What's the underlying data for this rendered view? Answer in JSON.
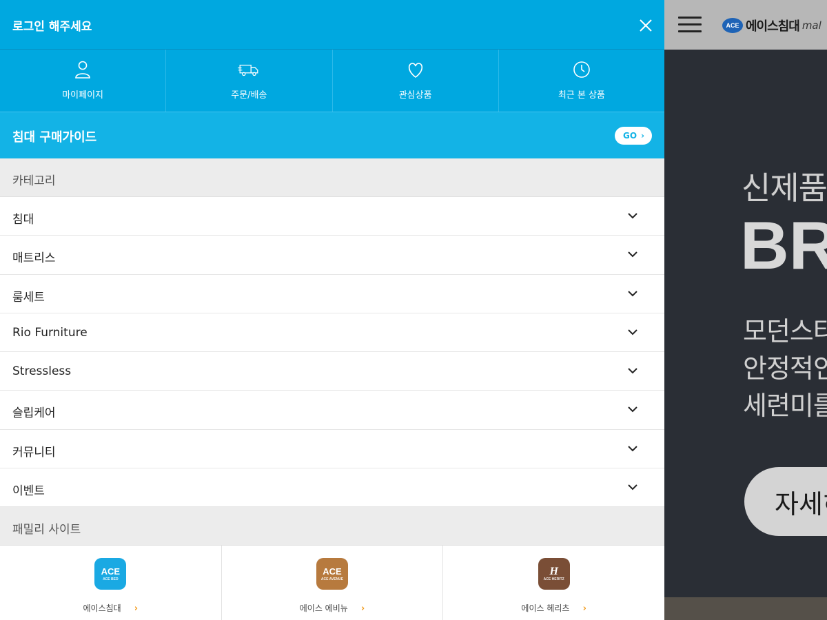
{
  "background": {
    "logo": {
      "badge": "ACE",
      "text": "에이스침대",
      "suffix": "mal"
    },
    "hero": {
      "subtitle": "신제품",
      "title": "BR",
      "lines": [
        "모던스타",
        "안정적인",
        "세련미를"
      ],
      "button": "자세히"
    }
  },
  "drawer": {
    "login_prompt": "로그인 해주세요",
    "quick_menu": [
      {
        "label": "마이페이지",
        "icon": "person-icon"
      },
      {
        "label": "주문/배송",
        "icon": "delivery-truck-icon"
      },
      {
        "label": "관심상품",
        "icon": "heart-icon"
      },
      {
        "label": "최근 본 상품",
        "icon": "clock-icon"
      }
    ],
    "buy_guide": {
      "label": "침대 구매가이드",
      "go": "GO"
    },
    "category_header": "카테고리",
    "categories": [
      "침대",
      "매트리스",
      "룸세트",
      "Rio Furniture",
      "Stressless",
      "슬립케어",
      "커뮤니티",
      "이벤트"
    ],
    "family_header": "패밀리 사이트",
    "family_sites": [
      {
        "label": "에이스침대",
        "logo": "ACE",
        "logo_sub": "ACE BED",
        "color": "#1aa9e3"
      },
      {
        "label": "에이스 에비뉴",
        "logo": "ACE",
        "logo_sub": "ACE AVENUE",
        "color": "#b77a3e"
      },
      {
        "label": "에이스 헤리츠",
        "logo": "H",
        "logo_sub": "ACE HERITZ",
        "color": "#7a4e36"
      }
    ]
  }
}
